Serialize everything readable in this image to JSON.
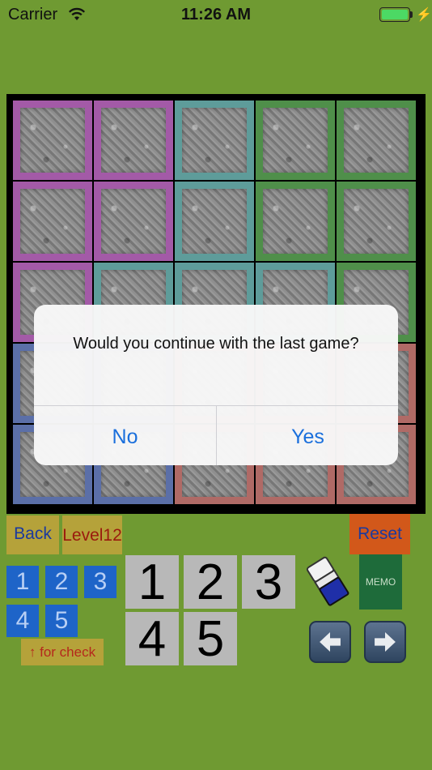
{
  "status_bar": {
    "carrier": "Carrier",
    "time": "11:26 AM"
  },
  "board": {
    "rows": [
      [
        "#a35aa7",
        "#a35aa7",
        "#5e9c9a",
        "#4f8f4a",
        "#4f8f4a"
      ],
      [
        "#a35aa7",
        "#a35aa7",
        "#5e9c9a",
        "#4f8f4a",
        "#4f8f4a"
      ],
      [
        "#a35aa7",
        "#5e9c9a",
        "#5e9c9a",
        "#5e9c9a",
        "#4f8f4a"
      ],
      [
        "#5b6fa8",
        "#5b6fa8",
        "#b06a66",
        "#b06a66",
        "#b06a66"
      ],
      [
        "#5b6fa8",
        "#5b6fa8",
        "#b06a66",
        "#b06a66",
        "#b06a66"
      ]
    ]
  },
  "dialog": {
    "message": "Would you continue with the last game?",
    "no_label": "No",
    "yes_label": "Yes"
  },
  "controls": {
    "back_label": "Back",
    "level_label": "Level12",
    "reset_label": "Reset",
    "small_numbers": [
      "1",
      "2",
      "3",
      "4",
      "5"
    ],
    "check_label": "↑ for check",
    "big_numbers": [
      "1",
      "2",
      "3",
      "4",
      "5"
    ],
    "memo_label": "MEMO",
    "eraser_icon": "eraser-icon",
    "left_icon": "arrow-left-icon",
    "right_icon": "arrow-right-icon"
  },
  "colors": {
    "background": "#6f9a32",
    "dialog_button": "#1a6fdc"
  }
}
